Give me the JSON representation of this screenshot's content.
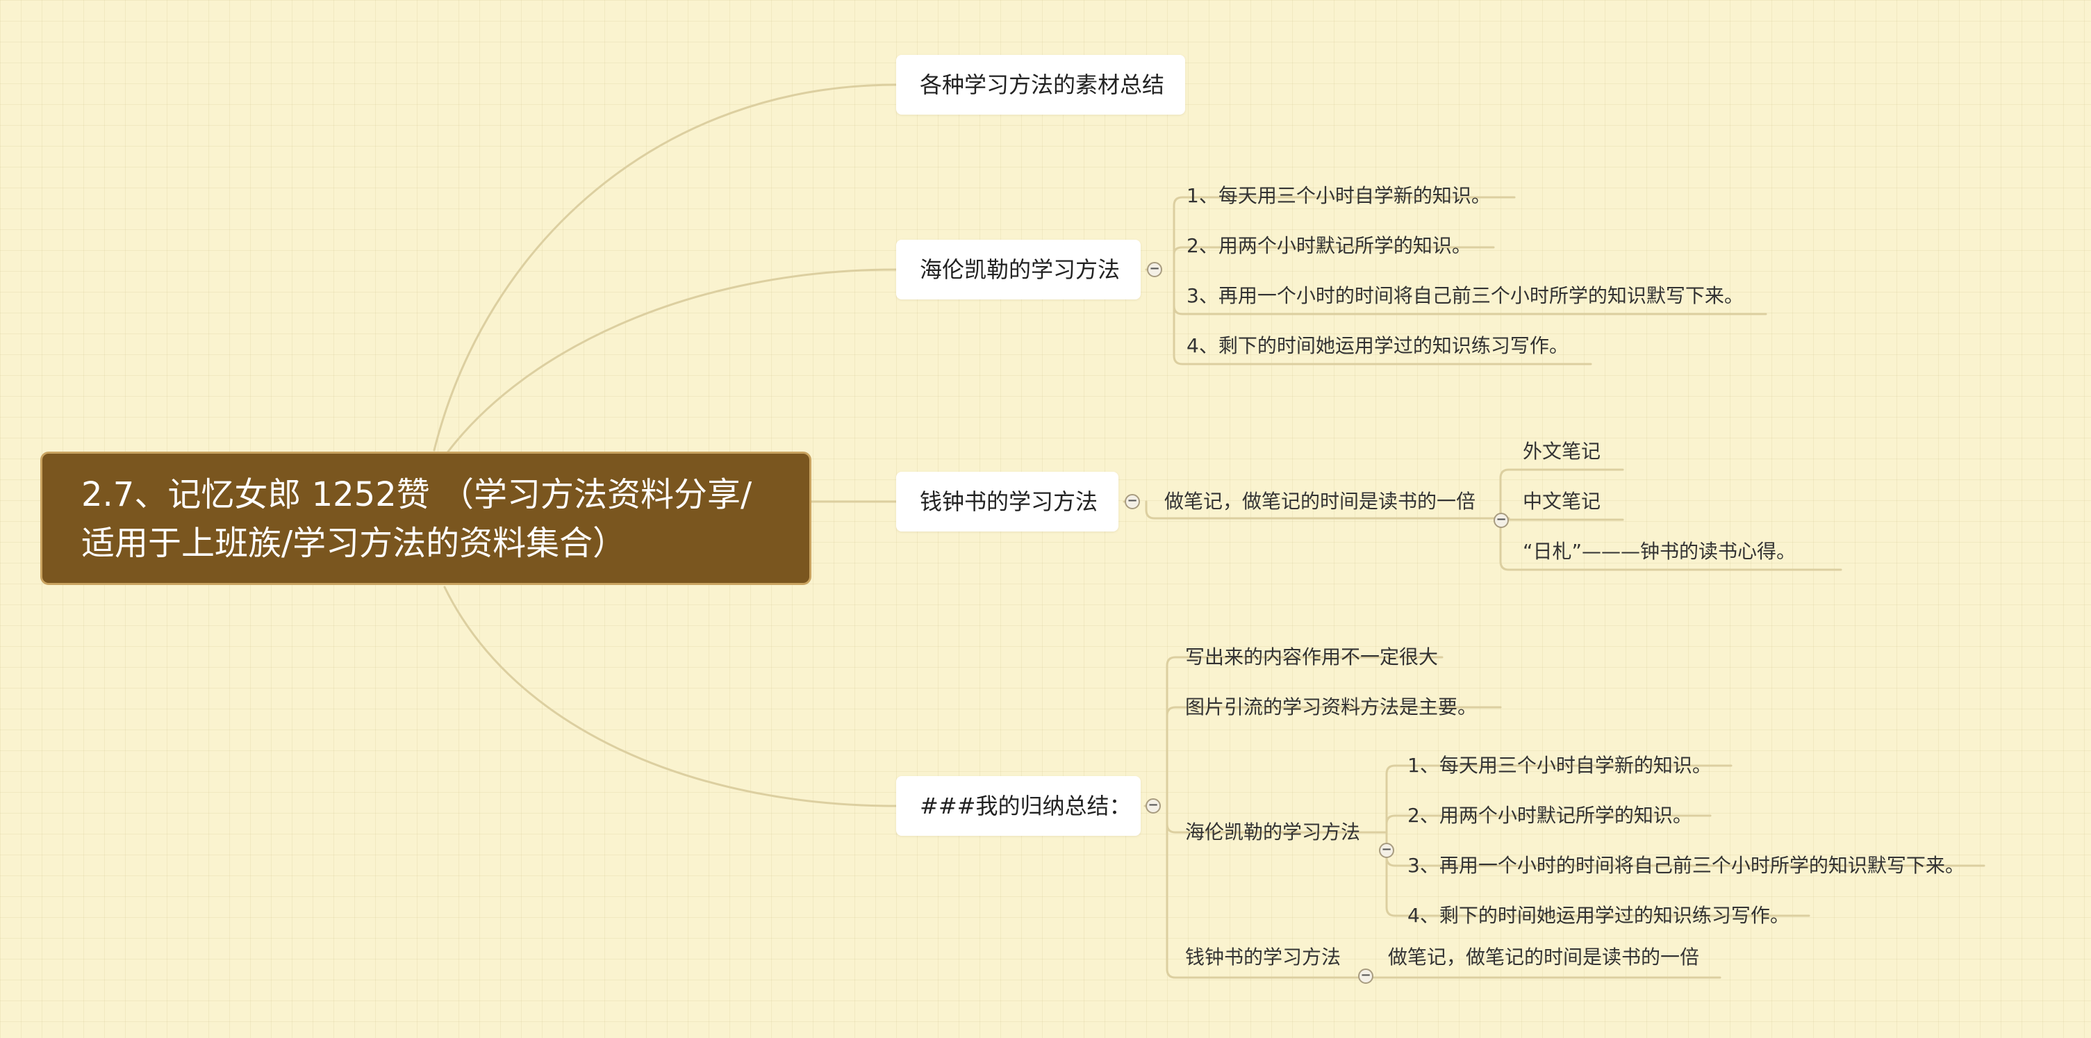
{
  "central": {
    "text": "2.7、记忆女郎  1252赞 （学习方法资料分享/\n适用于上班族/学习方法的资料集合）"
  },
  "topics": {
    "materials": "各种学习方法的素材总结",
    "keller": {
      "title": "海伦凯勒的学习方法",
      "items": [
        "1、每天用三个小时自学新的知识。",
        "2、用两个小时默记所学的知识。",
        "3、再用一个小时的时间将自己前三个小时所学的知识默写下来。",
        "4、剩下的时间她运用学过的知识练习写作。"
      ]
    },
    "qian": {
      "title": "钱钟书的学习方法",
      "note": "做笔记，做笔记的时间是读书的一倍",
      "items": [
        "外文笔记",
        "中文笔记",
        "“日札”———钟书的读书心得。"
      ]
    },
    "summary": {
      "title": "###我的归纳总结：",
      "points": [
        "写出来的内容作用不一定很大",
        "图片引流的学习资料方法是主要。"
      ],
      "keller": {
        "title": "海伦凯勒的学习方法",
        "items": [
          "1、每天用三个小时自学新的知识。",
          "2、用两个小时默记所学的知识。",
          "3、再用一个小时的时间将自己前三个小时所学的知识默写下来。",
          "4、剩下的时间她运用学过的知识练习写作。"
        ]
      },
      "qian": {
        "title": "钱钟书的学习方法",
        "note": "做笔记，做笔记的时间是读书的一倍"
      }
    }
  },
  "collapse_symbol": "−",
  "colors": {
    "background": "#faf3cf",
    "central_fill": "#7a561f",
    "central_border": "#c9a360",
    "connector": "#dccfa0",
    "text": "#333333"
  }
}
